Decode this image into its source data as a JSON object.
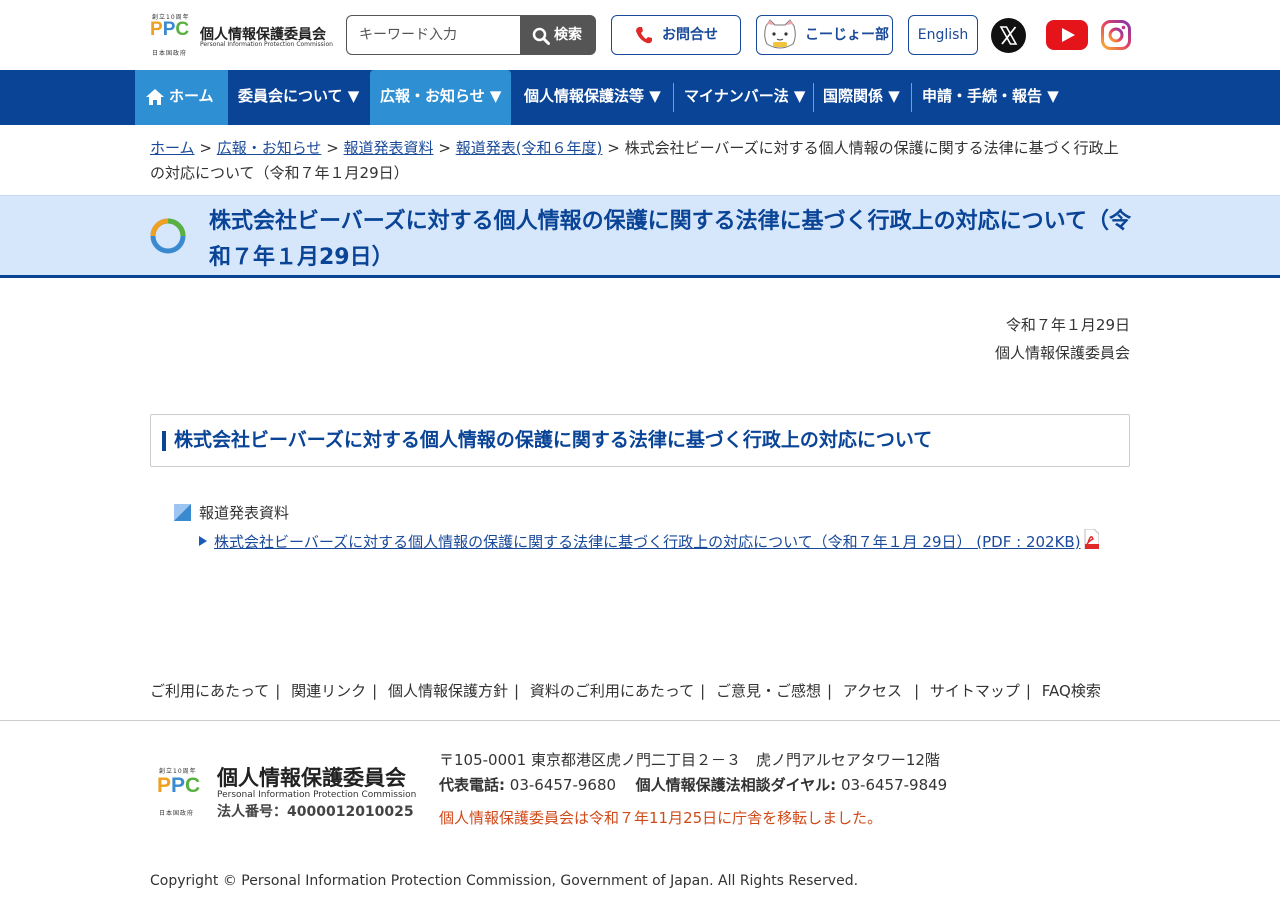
{
  "header": {
    "logo": {
      "ppc": "PPC",
      "name": "個人情報保護委員会",
      "sub_en": "Personal Information Protection Commission",
      "top_small": "創立10周年",
      "bottom_small": "日本国政府"
    },
    "search_placeholder": "キーワード入力",
    "search_label": "検索",
    "contact_label": "お問合せ",
    "kojo_label": "こーじょー部",
    "english_label": "English",
    "sns_icons": [
      "x-icon",
      "youtube-icon",
      "instagram-icon"
    ]
  },
  "nav": {
    "items": [
      {
        "label": "ホーム",
        "icon": "home-icon"
      },
      {
        "label": "委員会について ▼"
      },
      {
        "label": "広報・お知らせ ▼"
      },
      {
        "label": "個人情報保護法等 ▼"
      },
      {
        "label": "マイナンバー法 ▼"
      },
      {
        "label": "国際関係 ▼"
      },
      {
        "label": "申請・手続・報告 ▼"
      }
    ]
  },
  "breadcrumb": {
    "items": [
      "ホーム",
      "広報・お知らせ",
      "報道発表資料",
      "報道発表(令和６年度)"
    ],
    "separator": ">",
    "current": "株式会社ビーバーズに対する個人情報の保護に関する法律に基づく行政上の対応について（令和７年１月29日）"
  },
  "page_title": "株式会社ビーバーズに対する個人情報の保護に関する法律に基づく行政上の対応について（令和７年１月29日）",
  "date": "令和７年１月29日",
  "issuer": "個人情報保護委員会",
  "section_heading": "株式会社ビーバーズに対する個人情報の保護に関する法律に基づく行政上の対応について",
  "list": {
    "heading": "報道発表資料",
    "link": "株式会社ビーバーズに対する個人情報の保護に関する法律に基づく行政上の対応について（令和７年１月 29日） (PDF : 202KB)"
  },
  "footer": {
    "links": [
      "ご利用にあたって",
      "関連リンク",
      "個人情報保護方針",
      "資料のご利用にあたって",
      "ご意見・ご感想",
      "アクセス",
      "サイトマップ",
      "FAQ検索"
    ],
    "link_sep": "|",
    "logo_name": "個人情報保護委員会",
    "logo_sub": "Personal Information Protection Commission",
    "corp_number": "法人番号：4000012010025",
    "address": "〒105-0001 東京都港区虎ノ門二丁目２－３　虎ノ門アルセアタワー12階",
    "tel_main_label": "代表電話:",
    "tel_main": "03-6457-9680",
    "tel_consult_label": "個人情報保護法相談ダイヤル:",
    "tel_consult": "03-6457-9849",
    "notice": "個人情報保護委員会は令和７年11月25日に庁舎を移転しました。",
    "copyright": "Copyright © Personal Information Protection Commission, Government of Japan. All Rights Reserved."
  },
  "colors": {
    "nav_bg": "#0a4496",
    "nav_active": "#2e8fd2",
    "title_band": "#d6e6fb",
    "link": "#1a4a9a",
    "notice": "#d04a1a"
  }
}
